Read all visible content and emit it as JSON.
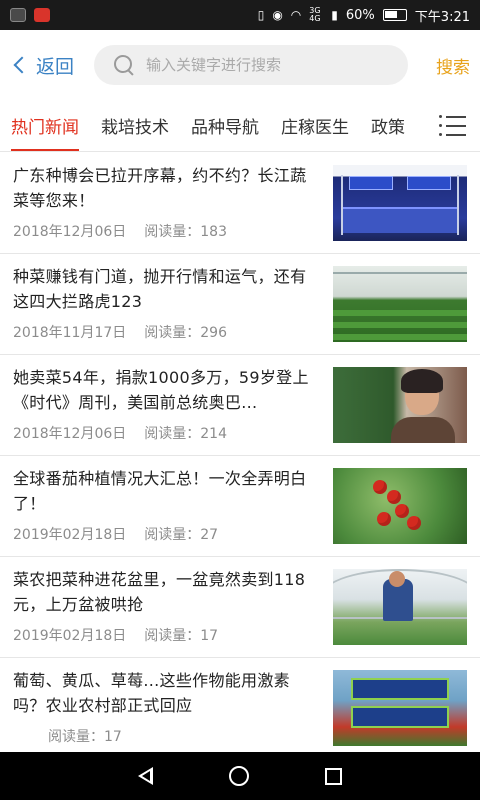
{
  "status_bar": {
    "battery_text": "60%",
    "time": "下午3:21",
    "network": "3G 4G"
  },
  "header": {
    "back_label": "返回",
    "search_placeholder": "输入关键字进行搜索",
    "search_button": "搜索"
  },
  "tabs": [
    {
      "label": "热门新闻",
      "active": true
    },
    {
      "label": "栽培技术",
      "active": false
    },
    {
      "label": "品种导航",
      "active": false
    },
    {
      "label": "庄稼医生",
      "active": false
    },
    {
      "label": "政策",
      "active": false
    }
  ],
  "articles": [
    {
      "title": "广东种博会已拉开序幕，约不约？长江蔬菜等您来！",
      "date": "2018年12月06日",
      "reads": "阅读量：183"
    },
    {
      "title": "种菜赚钱有门道，抛开行情和运气，还有这四大拦路虎123",
      "date": "2018年11月17日",
      "reads": "阅读量：296"
    },
    {
      "title": "她卖菜54年，捐款1000多万，59岁登上《时代》周刊，美国前总统奥巴...",
      "date": "2018年12月06日",
      "reads": "阅读量：214"
    },
    {
      "title": "全球番茄种植情况大汇总！一次全弄明白了！",
      "date": "2019年02月18日",
      "reads": "阅读量：27"
    },
    {
      "title": "菜农把菜种进花盆里，一盆竟然卖到118元，上万盆被哄抢",
      "date": "2019年02月18日",
      "reads": "阅读量：17"
    },
    {
      "title": "葡萄、黄瓜、草莓...这些作物能用激素吗？农业农村部正式回应",
      "date": "",
      "reads": "阅读量：17"
    }
  ]
}
